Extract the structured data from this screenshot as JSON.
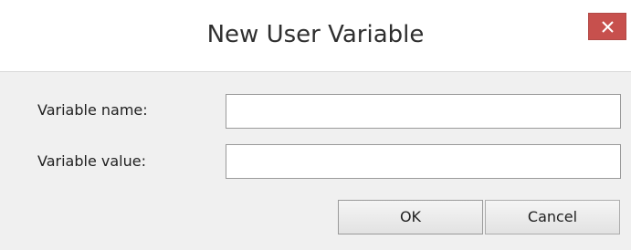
{
  "dialog": {
    "title": "New User Variable",
    "close_icon": "close-icon",
    "accent_close_color": "#c7504d"
  },
  "fields": {
    "name_label": "Variable name:",
    "name_value": "",
    "value_label": "Variable value:",
    "value_value": ""
  },
  "buttons": {
    "ok_label": "OK",
    "cancel_label": "Cancel"
  }
}
